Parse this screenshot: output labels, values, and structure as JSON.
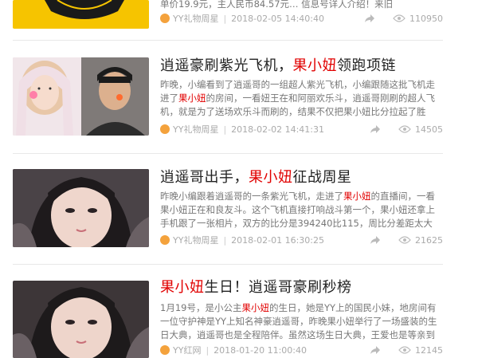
{
  "feed": {
    "items": [
      {
        "title_parts": [],
        "summary_text": "单价19.9元，主人民币84.57元…  信息号详人介绍！来旧",
        "source": "YY礼物周星",
        "time": "2018-02-05 14:40:40",
        "views": "110950"
      },
      {
        "title_pre": "逍遥豪刷紫光飞机，",
        "title_hl": "果小妞",
        "title_post": "领跑项链",
        "summary_pre": "昨晚，小编看到了逍遥哥的一组超人紫光飞机，小编跟随这批飞机走进了",
        "summary_hl": "果小妞",
        "summary_post": "的房间，一看妞王在和阿丽欢乐斗，逍遥哥刚刷的超人飞机，就是为了送场欢乐斗而刷的，结果不仅把果小妞比分拉起了胜利，逍遥哥60",
        "source": "YY礼物周星",
        "time": "2018-02-02 14:41:31",
        "views": "14505"
      },
      {
        "title_pre": "逍遥哥出手，",
        "title_hl": "果小妞",
        "title_post": "征战周星",
        "summary_pre": "昨晚小编跟着逍遥哥的一条紫光飞机，走进了",
        "summary_hl": "果小妞",
        "summary_post": "的直播间，一看果小妞正在和良友斗。这个飞机直接打响战斗第一个，果小妞还拿上手机跟了一张相片，双方的比分是394240比115，周比分差距太大了，果",
        "source": "YY礼物周星",
        "time": "2018-02-01 16:30:25",
        "views": "21625"
      },
      {
        "title_pre": "",
        "title_hl": "果小妞",
        "title_post": "生日！逍遥哥豪刷秒榜",
        "summary_pre": "1月19号，是小公主",
        "summary_hl": "果小妞",
        "summary_post": "的生日，她是YY上的国民小妹，地房间有一位守护神是YY上知名神豪逍遥哥，昨晚果小妞举行了一场盛装的生日大典，逍遥哥也是全程陪伴。虽然这场生日大典，王爱也是等亲到中期时间",
        "source": "YY红网",
        "time": "2018-01-20 11:00:40",
        "views": "12145"
      }
    ]
  },
  "colors": {
    "highlight": "#e10000",
    "meta": "#aaaaaa",
    "source_icon": "#f4a23c"
  }
}
